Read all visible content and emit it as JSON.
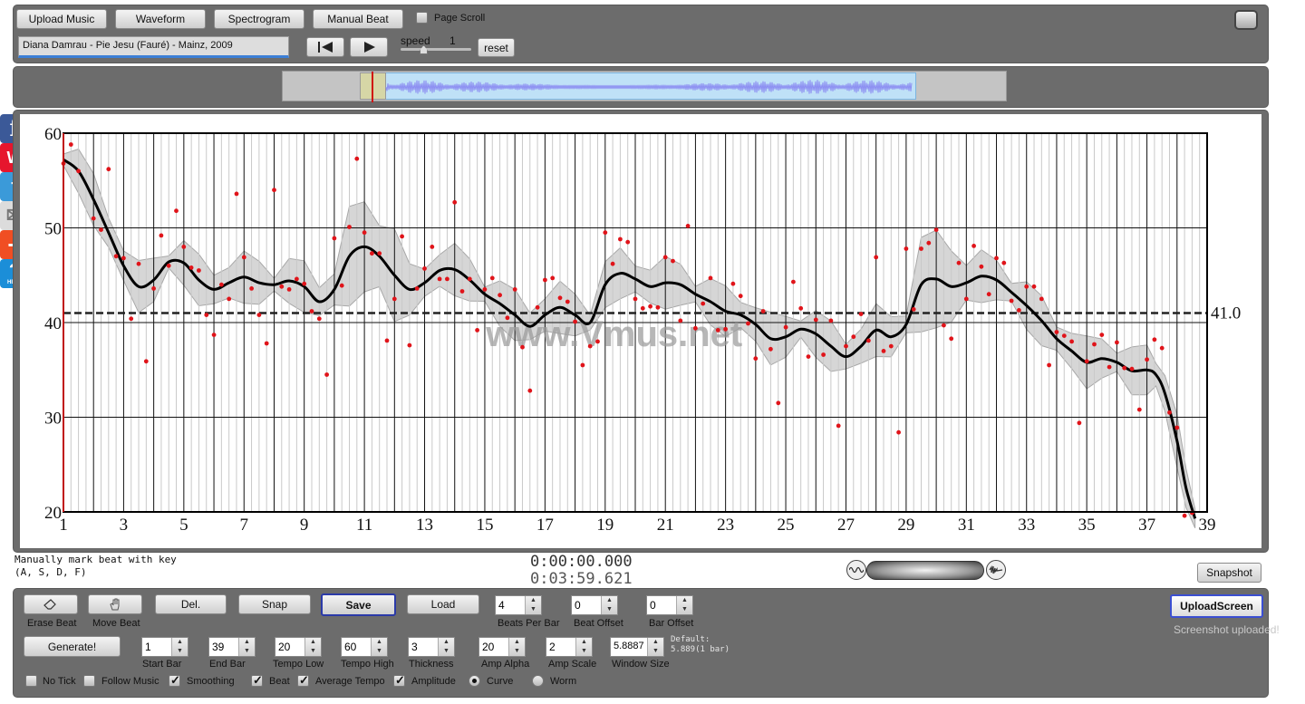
{
  "toolbar": {
    "upload_music": "Upload Music",
    "waveform": "Waveform",
    "spectrogram": "Spectrogram",
    "manual_beat": "Manual Beat",
    "page_scroll": "Page Scroll",
    "track_title": "Diana Damrau - Pie Jesu (Fauré) - Mainz, 2009",
    "speed_label": "speed",
    "speed_value": "1",
    "reset": "reset"
  },
  "chart_data": {
    "type": "scatter",
    "ylim": [
      20,
      60
    ],
    "xlim": [
      1,
      39
    ],
    "y_ticks": [
      "60",
      "50",
      "40",
      "30",
      "20"
    ],
    "x_ticks": [
      "1",
      "3",
      "5",
      "7",
      "9",
      "11",
      "13",
      "15",
      "17",
      "19",
      "21",
      "23",
      "25",
      "27",
      "29",
      "31",
      "33",
      "35",
      "37",
      "39"
    ],
    "average_label": "41.0",
    "average": 41.0,
    "watermark": "www.Vmus.net",
    "curve": [
      [
        1.0,
        57.2
      ],
      [
        1.5,
        56.0
      ],
      [
        2.0,
        53.0
      ],
      [
        2.5,
        49.5
      ],
      [
        3.0,
        46.0
      ],
      [
        3.5,
        43.8
      ],
      [
        4.0,
        44.5
      ],
      [
        4.5,
        46.4
      ],
      [
        5.0,
        46.3
      ],
      [
        5.5,
        44.5
      ],
      [
        6.0,
        43.5
      ],
      [
        6.5,
        44.2
      ],
      [
        7.0,
        44.8
      ],
      [
        7.5,
        44.2
      ],
      [
        8.0,
        44.0
      ],
      [
        8.5,
        44.4
      ],
      [
        9.0,
        43.8
      ],
      [
        9.5,
        42.2
      ],
      [
        10.0,
        43.5
      ],
      [
        10.5,
        47.0
      ],
      [
        11.0,
        48.0
      ],
      [
        11.5,
        47.0
      ],
      [
        12.0,
        45.0
      ],
      [
        12.5,
        43.5
      ],
      [
        13.0,
        44.2
      ],
      [
        13.5,
        45.5
      ],
      [
        14.0,
        45.6
      ],
      [
        14.5,
        44.5
      ],
      [
        15.0,
        43.0
      ],
      [
        15.5,
        42.0
      ],
      [
        16.0,
        40.8
      ],
      [
        16.5,
        39.6
      ],
      [
        17.0,
        40.8
      ],
      [
        17.5,
        41.6
      ],
      [
        18.0,
        40.8
      ],
      [
        18.5,
        40.0
      ],
      [
        19.0,
        44.0
      ],
      [
        19.5,
        45.2
      ],
      [
        20.0,
        44.6
      ],
      [
        20.5,
        43.8
      ],
      [
        21.0,
        44.2
      ],
      [
        21.5,
        44.0
      ],
      [
        22.0,
        43.0
      ],
      [
        22.5,
        42.2
      ],
      [
        23.0,
        41.2
      ],
      [
        23.5,
        40.8
      ],
      [
        24.0,
        39.8
      ],
      [
        24.5,
        38.3
      ],
      [
        25.0,
        38.5
      ],
      [
        25.5,
        39.3
      ],
      [
        26.0,
        38.8
      ],
      [
        26.5,
        37.5
      ],
      [
        27.0,
        36.4
      ],
      [
        27.5,
        37.5
      ],
      [
        28.0,
        39.2
      ],
      [
        28.5,
        38.5
      ],
      [
        29.0,
        39.8
      ],
      [
        29.5,
        44.0
      ],
      [
        30.0,
        44.6
      ],
      [
        30.5,
        43.8
      ],
      [
        31.0,
        44.2
      ],
      [
        31.5,
        44.9
      ],
      [
        32.0,
        44.5
      ],
      [
        32.5,
        43.2
      ],
      [
        33.0,
        41.8
      ],
      [
        33.5,
        40.2
      ],
      [
        34.0,
        38.3
      ],
      [
        34.5,
        37.0
      ],
      [
        35.0,
        35.8
      ],
      [
        35.5,
        36.2
      ],
      [
        36.0,
        35.8
      ],
      [
        36.5,
        34.9
      ],
      [
        37.0,
        35.0
      ],
      [
        37.3,
        34.5
      ],
      [
        37.6,
        32.5
      ],
      [
        38.0,
        27.5
      ],
      [
        38.3,
        22.5
      ],
      [
        38.6,
        19.3
      ]
    ],
    "points": [
      [
        1.0,
        56.8
      ],
      [
        1.25,
        58.8
      ],
      [
        1.5,
        56.0
      ],
      [
        2.0,
        51.0
      ],
      [
        2.25,
        49.8
      ],
      [
        2.5,
        56.2
      ],
      [
        2.75,
        47.0
      ],
      [
        3.0,
        46.8
      ],
      [
        3.25,
        40.4
      ],
      [
        3.5,
        46.2
      ],
      [
        3.75,
        35.9
      ],
      [
        4.0,
        43.6
      ],
      [
        4.25,
        49.2
      ],
      [
        4.5,
        46.0
      ],
      [
        4.75,
        51.8
      ],
      [
        5.0,
        48.0
      ],
      [
        5.25,
        45.8
      ],
      [
        5.5,
        45.5
      ],
      [
        5.75,
        40.8
      ],
      [
        6.0,
        38.7
      ],
      [
        6.25,
        44.0
      ],
      [
        6.5,
        42.5
      ],
      [
        6.75,
        53.6
      ],
      [
        7.0,
        46.9
      ],
      [
        7.25,
        43.6
      ],
      [
        7.5,
        40.8
      ],
      [
        7.75,
        37.8
      ],
      [
        8.0,
        54.0
      ],
      [
        8.25,
        43.8
      ],
      [
        8.5,
        43.5
      ],
      [
        8.75,
        44.6
      ],
      [
        9.0,
        44.1
      ],
      [
        9.25,
        41.2
      ],
      [
        9.5,
        40.4
      ],
      [
        9.75,
        34.5
      ],
      [
        10.0,
        48.9
      ],
      [
        10.25,
        43.9
      ],
      [
        10.5,
        50.1
      ],
      [
        10.75,
        57.3
      ],
      [
        11.0,
        49.5
      ],
      [
        11.25,
        47.3
      ],
      [
        11.5,
        47.3
      ],
      [
        11.75,
        38.1
      ],
      [
        12.0,
        42.5
      ],
      [
        12.25,
        49.1
      ],
      [
        12.5,
        37.6
      ],
      [
        12.75,
        43.6
      ],
      [
        13.0,
        45.7
      ],
      [
        13.25,
        48.0
      ],
      [
        13.5,
        44.6
      ],
      [
        13.75,
        44.6
      ],
      [
        14.0,
        52.7
      ],
      [
        14.25,
        43.3
      ],
      [
        14.5,
        44.6
      ],
      [
        14.75,
        39.2
      ],
      [
        15.0,
        43.5
      ],
      [
        15.25,
        44.7
      ],
      [
        15.5,
        42.9
      ],
      [
        15.75,
        40.5
      ],
      [
        16.0,
        43.5
      ],
      [
        16.25,
        37.4
      ],
      [
        16.5,
        32.8
      ],
      [
        16.75,
        41.6
      ],
      [
        17.0,
        44.5
      ],
      [
        17.25,
        44.7
      ],
      [
        17.5,
        42.6
      ],
      [
        17.75,
        42.2
      ],
      [
        18.0,
        40.1
      ],
      [
        18.25,
        35.5
      ],
      [
        18.5,
        37.5
      ],
      [
        18.75,
        38.0
      ],
      [
        19.0,
        49.5
      ],
      [
        19.25,
        46.2
      ],
      [
        19.5,
        48.8
      ],
      [
        19.75,
        48.5
      ],
      [
        20.0,
        42.5
      ],
      [
        20.25,
        41.5
      ],
      [
        20.5,
        41.7
      ],
      [
        20.75,
        41.6
      ],
      [
        21.0,
        46.9
      ],
      [
        21.25,
        46.5
      ],
      [
        21.5,
        40.2
      ],
      [
        21.75,
        50.2
      ],
      [
        22.0,
        39.4
      ],
      [
        22.25,
        42.0
      ],
      [
        22.5,
        44.7
      ],
      [
        22.75,
        39.2
      ],
      [
        23.0,
        39.3
      ],
      [
        23.25,
        44.1
      ],
      [
        23.5,
        42.8
      ],
      [
        23.75,
        39.9
      ],
      [
        24.0,
        36.2
      ],
      [
        24.25,
        41.2
      ],
      [
        24.5,
        37.2
      ],
      [
        24.75,
        31.5
      ],
      [
        25.0,
        39.5
      ],
      [
        25.25,
        44.3
      ],
      [
        25.5,
        41.5
      ],
      [
        25.75,
        36.4
      ],
      [
        26.0,
        40.3
      ],
      [
        26.25,
        36.6
      ],
      [
        26.5,
        40.2
      ],
      [
        26.75,
        29.1
      ],
      [
        27.0,
        37.5
      ],
      [
        27.25,
        38.5
      ],
      [
        27.5,
        40.9
      ],
      [
        27.75,
        38.1
      ],
      [
        28.0,
        46.9
      ],
      [
        28.25,
        37.0
      ],
      [
        28.5,
        37.5
      ],
      [
        28.75,
        28.4
      ],
      [
        29.0,
        47.8
      ],
      [
        29.25,
        41.4
      ],
      [
        29.5,
        47.8
      ],
      [
        29.75,
        48.4
      ],
      [
        30.0,
        49.8
      ],
      [
        30.25,
        39.7
      ],
      [
        30.5,
        38.3
      ],
      [
        30.75,
        46.3
      ],
      [
        31.0,
        42.5
      ],
      [
        31.25,
        48.1
      ],
      [
        31.5,
        45.9
      ],
      [
        31.75,
        43.0
      ],
      [
        32.0,
        46.8
      ],
      [
        32.25,
        46.3
      ],
      [
        32.5,
        42.3
      ],
      [
        32.75,
        41.3
      ],
      [
        33.0,
        43.8
      ],
      [
        33.25,
        43.8
      ],
      [
        33.5,
        42.5
      ],
      [
        33.75,
        35.5
      ],
      [
        34.0,
        39.0
      ],
      [
        34.25,
        38.6
      ],
      [
        34.5,
        38.0
      ],
      [
        34.75,
        29.4
      ],
      [
        35.0,
        35.9
      ],
      [
        35.25,
        37.7
      ],
      [
        35.5,
        38.7
      ],
      [
        35.75,
        35.3
      ],
      [
        36.0,
        37.9
      ],
      [
        36.25,
        35.2
      ],
      [
        36.5,
        35.1
      ],
      [
        36.75,
        30.8
      ],
      [
        37.0,
        36.1
      ],
      [
        37.25,
        38.2
      ],
      [
        37.5,
        37.3
      ],
      [
        37.75,
        30.5
      ],
      [
        38.0,
        28.9
      ],
      [
        38.25,
        19.6
      ],
      [
        38.5,
        19.9
      ]
    ]
  },
  "status": {
    "hint_line1": "Manually mark beat with key",
    "hint_line2": "(A, S, D, F)",
    "time_current": "0:00:00.000",
    "time_total": "0:03:59.621",
    "snapshot": "Snapshot"
  },
  "controls": {
    "erase_beat": "Erase Beat",
    "move_beat": "Move Beat",
    "del": "Del.",
    "snap": "Snap",
    "save": "Save",
    "load": "Load",
    "beats_per_bar_label": "Beats Per Bar",
    "beats_per_bar": "4",
    "beat_offset_label": "Beat Offset",
    "beat_offset": "0",
    "bar_offset_label": "Bar Offset",
    "bar_offset": "0",
    "upload_screen": "UploadScreen",
    "screenshot_uploaded": "Screenshot uploaded!",
    "generate": "Generate!",
    "start_bar_label": "Start Bar",
    "start_bar": "1",
    "end_bar_label": "End Bar",
    "end_bar": "39",
    "tempo_low_label": "Tempo Low",
    "tempo_low": "20",
    "tempo_high_label": "Tempo High",
    "tempo_high": "60",
    "thickness_label": "Thickness",
    "thickness": "3",
    "amp_alpha_label": "Amp Alpha",
    "amp_alpha": "20",
    "amp_scale_label": "Amp Scale",
    "amp_scale": "2",
    "window_size_label": "Window Size",
    "window_size": "5.8887",
    "default_line1": "Default:",
    "default_line2": "5.889(1 bar)",
    "no_tick": "No Tick",
    "follow_music": "Follow Music",
    "smoothing": "Smoothing",
    "beat": "Beat",
    "average_tempo": "Average Tempo",
    "amplitude": "Amplitude",
    "curve": "Curve",
    "worm": "Worm"
  },
  "social": {
    "facebook": "f",
    "weibo": "W",
    "twitter": "t",
    "email": "✉",
    "share": "+",
    "help": "?",
    "help_text": "HELP"
  },
  "colors": {
    "panel": "#6c6c6c",
    "points": "#e0141a",
    "band": "#c8c8c8",
    "waveform": "#8d8ff2",
    "selection": "#bfe1f7"
  }
}
